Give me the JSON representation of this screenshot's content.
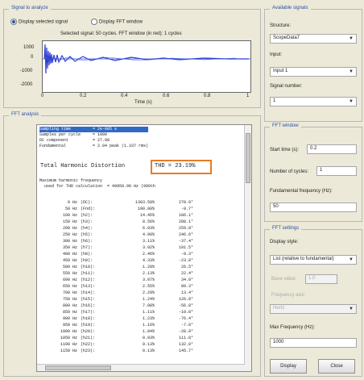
{
  "signal": {
    "title": "Signal to analyze",
    "radio1": "Display selected signal",
    "radio2": "Display FFT window",
    "plot_title": "Selected signal: 50 cycles. FFT window (in red): 1 cycles",
    "y_ticks": [
      "1000",
      "0",
      "-1000",
      "-2000"
    ],
    "x_ticks": [
      "0",
      "0.2",
      "0.4",
      "0.6",
      "0.8",
      "1"
    ],
    "x_label": "Time (s)"
  },
  "available": {
    "title": "Available signals",
    "structure_label": "Structure:",
    "structure_value": "ScopeData7",
    "input_label": "Input:",
    "input_value": "Input 1",
    "signal_label": "Signal number:",
    "signal_value": "1"
  },
  "fft_window": {
    "title": "FFT window",
    "start_label": "Start time (s):",
    "start_value": "0.2",
    "cycles_label": "Number of cycles:",
    "cycles_value": "1",
    "fund_label": "Fundamental frequency (Hz):",
    "fund_value": "50"
  },
  "fft_settings": {
    "title": "FFT settings",
    "display_label": "Display style:",
    "display_value": "List (relative to fundamental)",
    "base_label": "Base value:",
    "base_value": "1.0",
    "freq_axis_label": "Frequency axis:",
    "freq_axis_value": "Hertz",
    "maxfreq_label": "Max Frequency (Hz):",
    "maxfreq_value": "1000",
    "display_button": "Display",
    "close_button": "Close"
  },
  "fft_analysis": {
    "title": "FFT analysis",
    "header_lines": [
      "Sampling time         = 2e-005 s",
      "Samples per cycle     = 1000",
      "DC component          = 27.08",
      "Fundamental           = 2.04 peak (1.337 rms)"
    ],
    "thd_label": "Total Harmonic Distortion",
    "thd_value": "THD = 23.19%",
    "max_freq_lines": [
      "Maximum harmonic frequency",
      "  used for THD calculation  = 49950.00 Hz (999th"
    ],
    "table": [
      [
        "0 Hz",
        "(DC):",
        "1303.58%",
        "270.0°"
      ],
      [
        "50 Hz",
        "(Fnd):",
        "100.00%",
        "-0.7°"
      ],
      [
        "100 Hz",
        "(h2):",
        "14.45%",
        "186.1°"
      ],
      [
        "150 Hz",
        "(h3):",
        "8.56%",
        "288.1°"
      ],
      [
        "200 Hz",
        "(h4):",
        "6.03%",
        "259.8°"
      ],
      [
        "250 Hz",
        "(h5):",
        "4.99%",
        "246.6°"
      ],
      [
        "300 Hz",
        "(h6):",
        "3.11%",
        "-37.4°"
      ],
      [
        "350 Hz",
        "(h7):",
        "3.02%",
        "101.5°"
      ],
      [
        "400 Hz",
        "(h8):",
        "2.46%",
        "-8.3°"
      ],
      [
        "450 Hz",
        "(h9):",
        "4.33%",
        "-23.8°"
      ],
      [
        "500 Hz",
        "(h10):",
        "1.28%",
        "26.5°"
      ],
      [
        "550 Hz",
        "(h11):",
        "2.13%",
        "22.4°"
      ],
      [
        "600 Hz",
        "(h12):",
        "3.07%",
        "34.0°"
      ],
      [
        "650 Hz",
        "(h13):",
        "2.55%",
        "80.3°"
      ],
      [
        "700 Hz",
        "(h14):",
        "2.29%",
        "13.4°"
      ],
      [
        "750 Hz",
        "(h15):",
        "1.24%",
        "126.8°"
      ],
      [
        "800 Hz",
        "(h16):",
        "7.08%",
        "-56.8°"
      ],
      [
        "850 Hz",
        "(h17):",
        "1.11%",
        "-10.8°"
      ],
      [
        "900 Hz",
        "(h18):",
        "1.23%",
        "-76.4°"
      ],
      [
        "950 Hz",
        "(h19):",
        "1.16%",
        "-7.0°"
      ],
      [
        "1000 Hz",
        "(h20):",
        "1.04%",
        "-28.0°"
      ],
      [
        "1050 Hz",
        "(h21):",
        "0.93%",
        "111.8°"
      ],
      [
        "1100 Hz",
        "(h22):",
        "0.13%",
        "132.0°"
      ],
      [
        "1150 Hz",
        "(h23):",
        "0.13%",
        "145.7°"
      ]
    ]
  }
}
